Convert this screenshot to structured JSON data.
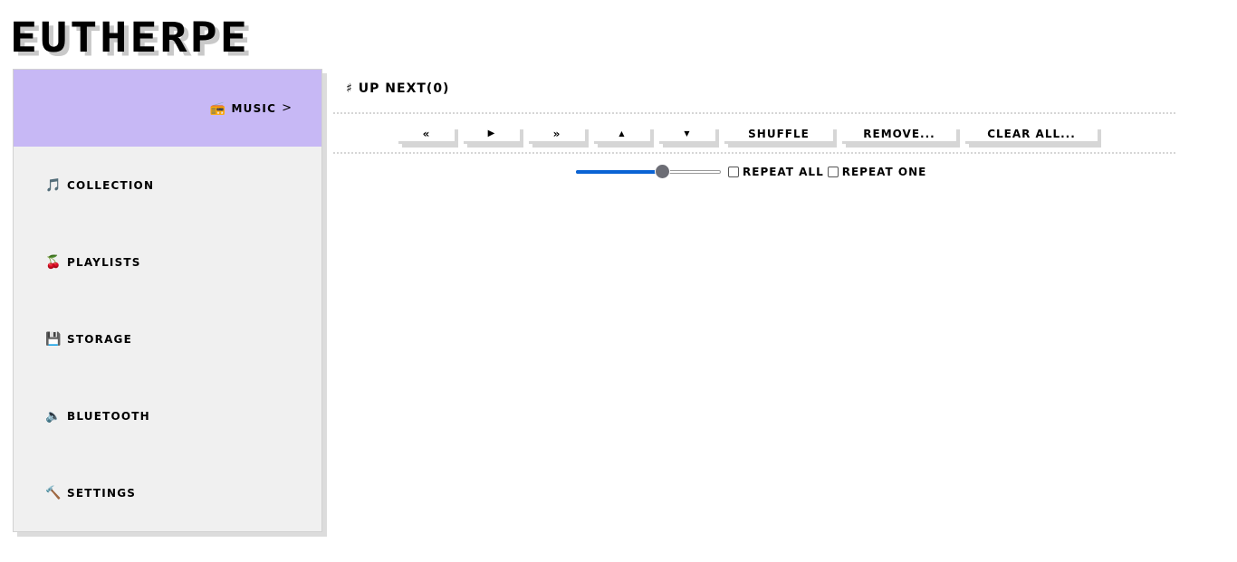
{
  "app": {
    "logo_text": "EUTHERPE"
  },
  "sidebar": {
    "items": [
      {
        "label": "MUSIC",
        "icon": "radio-icon",
        "glyph": "📻",
        "caret": ">",
        "active": true
      },
      {
        "label": "COLLECTION",
        "icon": "music-icon",
        "glyph": "🎵",
        "active": false
      },
      {
        "label": "PLAYLISTS",
        "icon": "cherries-icon",
        "glyph": "🍒",
        "active": false
      },
      {
        "label": "STORAGE",
        "icon": "floppy-disk-icon",
        "glyph": "💾",
        "active": false
      },
      {
        "label": "BLUETOOTH",
        "icon": "speaker-icon",
        "glyph": "🔈",
        "active": false
      },
      {
        "label": "SETTINGS",
        "icon": "hammer-icon",
        "glyph": "🔨",
        "active": false
      }
    ],
    "active_color": "#c7b8f5"
  },
  "queue": {
    "hash_glyph": "♯",
    "title": "UP NEXT",
    "count_text": "(0)"
  },
  "toolbar": {
    "previous_label": "«",
    "play_label": "▶",
    "next_label": "»",
    "move_up_label": "▲",
    "move_down_label": "▼",
    "shuffle_label": "SHUFFLE",
    "remove_label": "REMOVE...",
    "clear_all_label": "CLEAR ALL..."
  },
  "playback": {
    "volume_fraction": 0.6,
    "repeat_all_label": "REPEAT ALL",
    "repeat_one_label": "REPEAT ONE",
    "repeat_all_checked": false,
    "repeat_one_checked": false,
    "accent_color": "#0a63d4"
  }
}
